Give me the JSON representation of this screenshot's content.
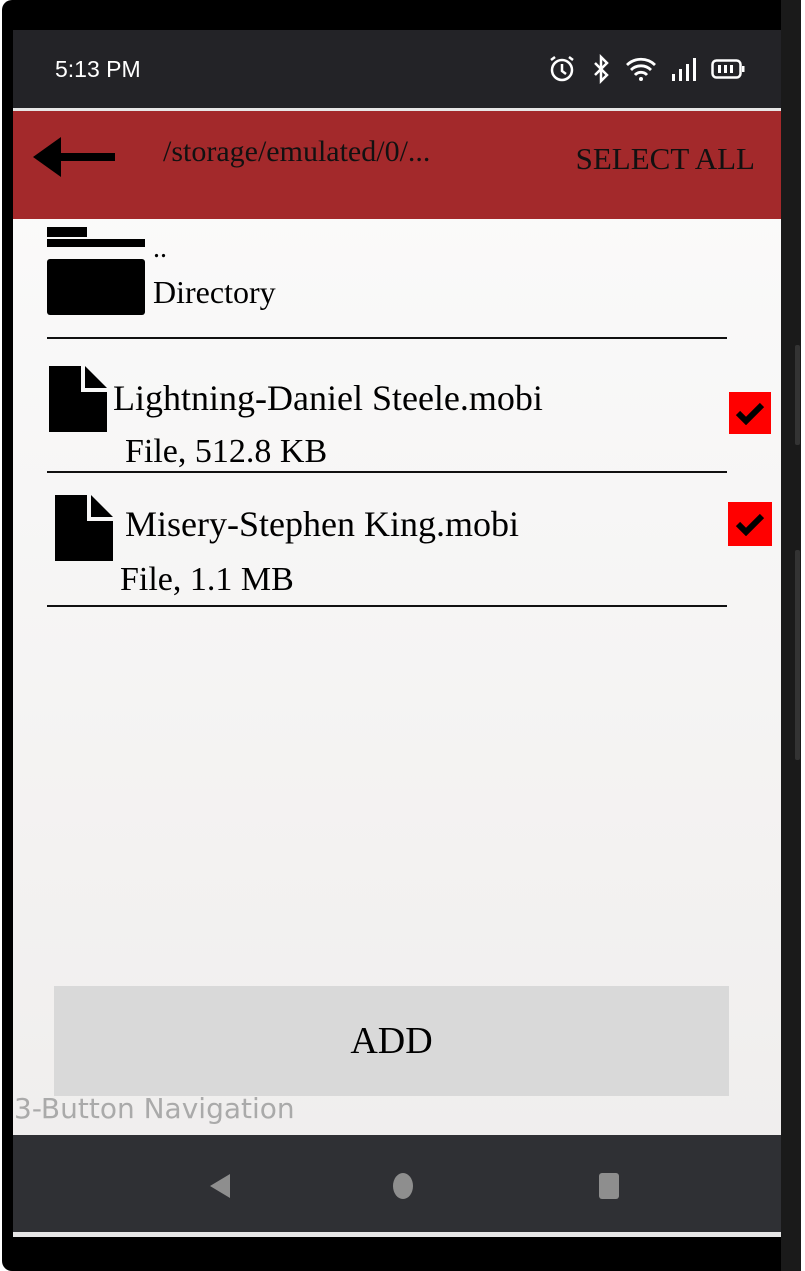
{
  "status_bar": {
    "time": "5:13 PM",
    "icons": [
      "alarm-icon",
      "bluetooth-icon",
      "wifi-icon",
      "signal-icon",
      "battery-icon"
    ]
  },
  "app_bar": {
    "path": "/storage/emulated/0/...",
    "select_all_label": "SELECT ALL",
    "accent_color": "#a3292b"
  },
  "entries": [
    {
      "name": "..",
      "detail": "Directory",
      "type": "folder"
    },
    {
      "name": "Lightning-Daniel Steele.mobi",
      "detail": "File, 512.8 KB",
      "type": "file",
      "checked": true
    },
    {
      "name": "Misery-Stephen King.mobi",
      "detail": "File, 1.1 MB",
      "type": "file",
      "checked": true
    }
  ],
  "add_button_label": "ADD",
  "nav_label": "3-Button Navigation"
}
